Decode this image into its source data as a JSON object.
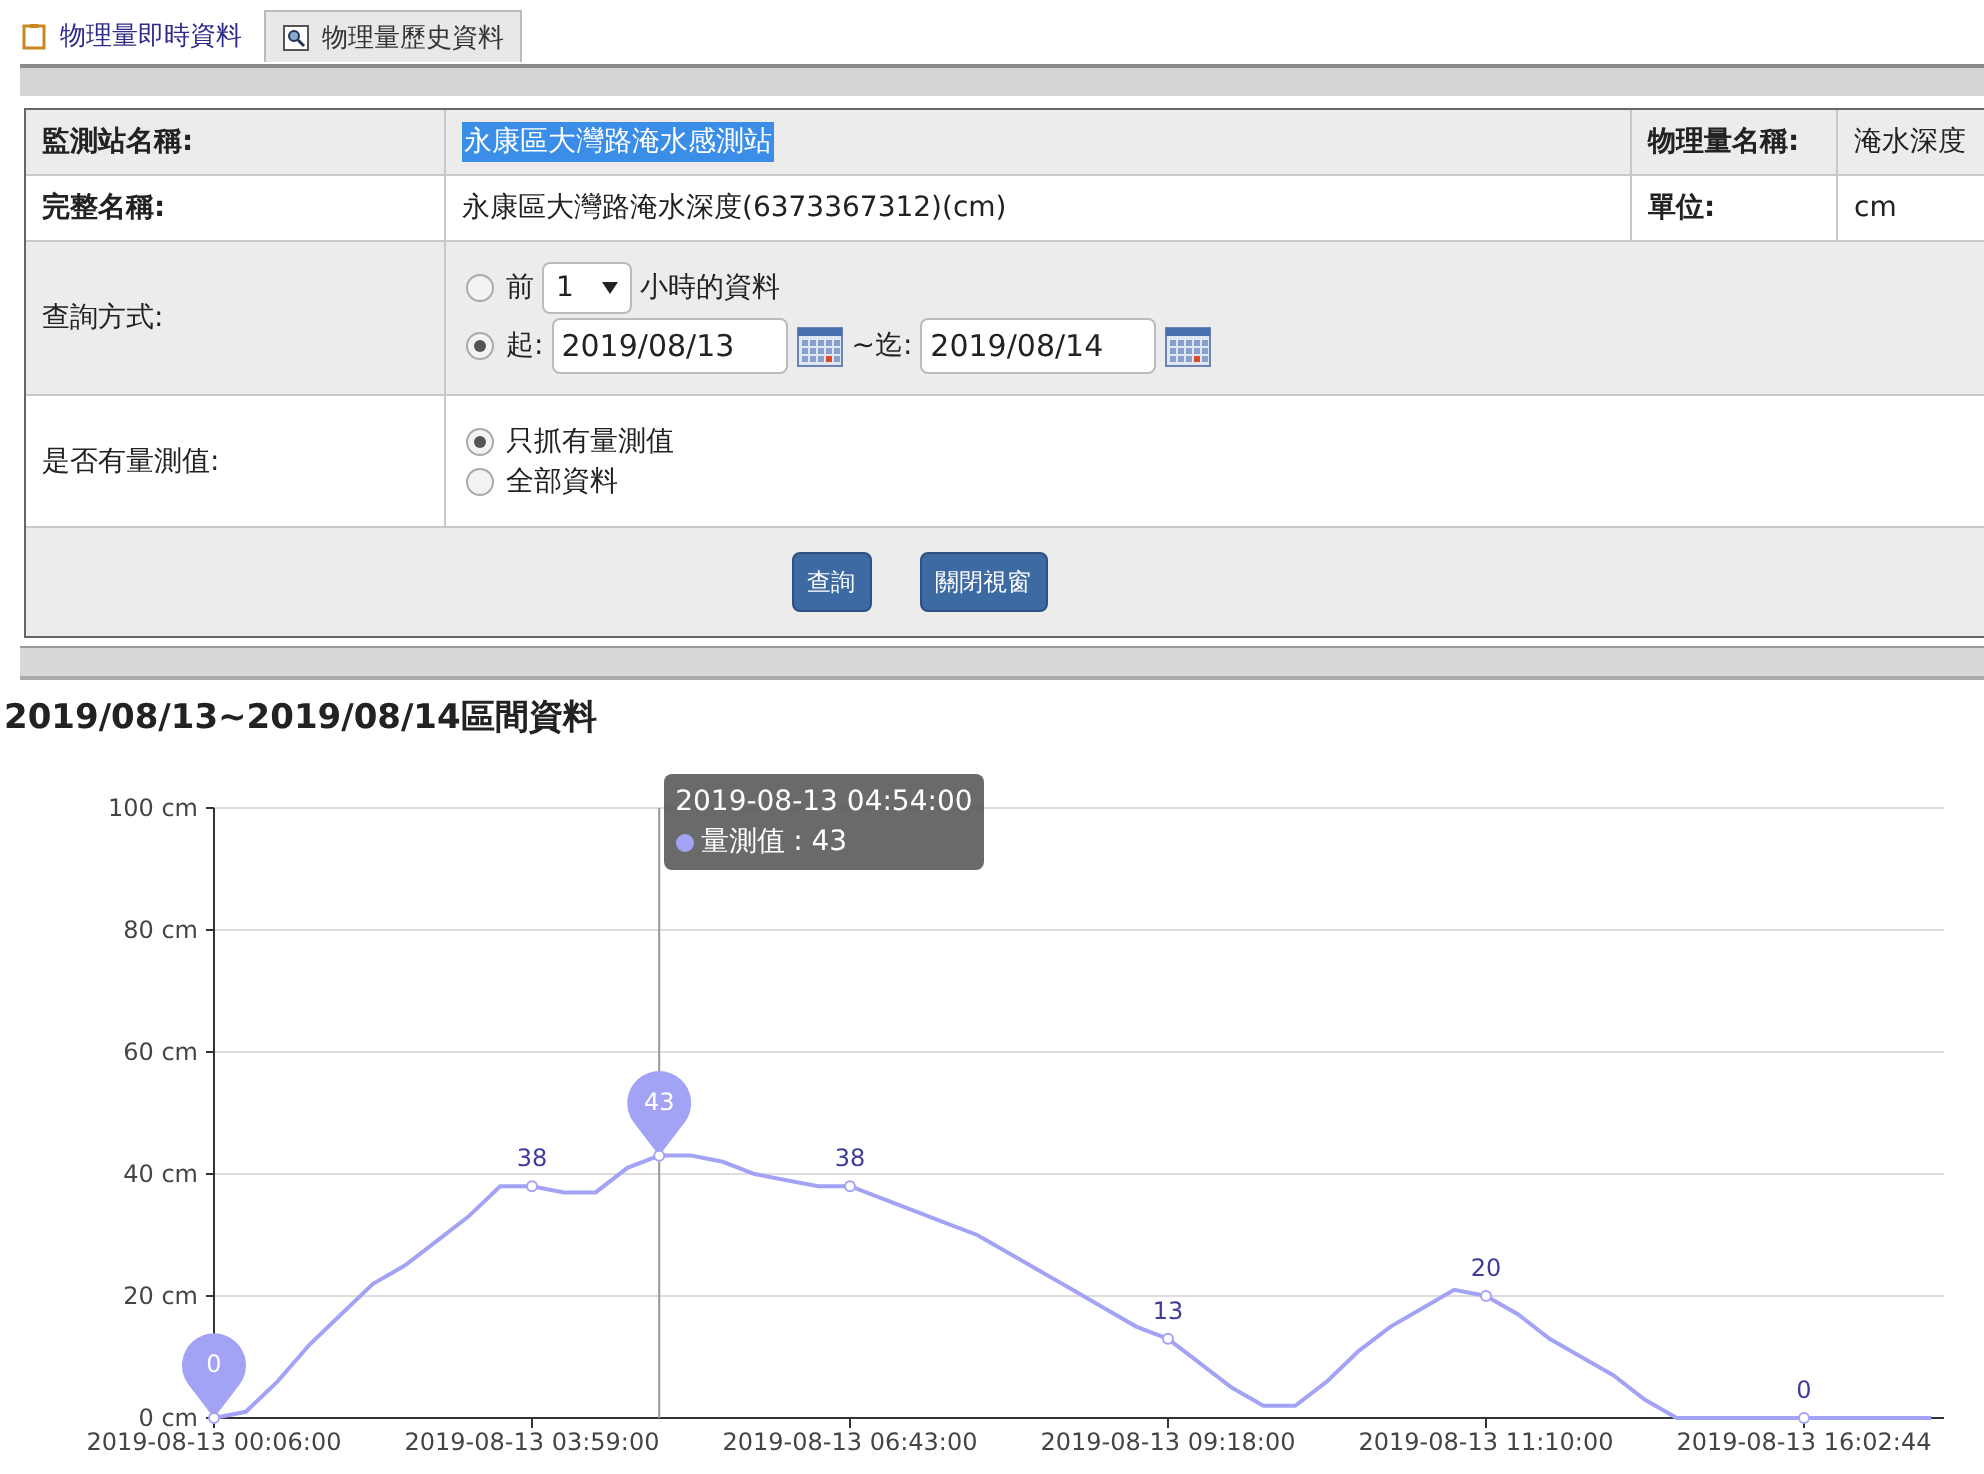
{
  "tabs": [
    {
      "label": "物理量即時資料",
      "selected": false
    },
    {
      "label": "物理量歷史資料",
      "selected": true
    }
  ],
  "info_rows": [
    {
      "label": "監測站名稱:",
      "value": "永康區大灣路淹水感測站",
      "highlighted": true,
      "label_2": "物理量名稱:",
      "value_2": "淹水深度"
    },
    {
      "label": "完整名稱:",
      "value": "永康區大灣路淹水深度(6373367312)(cm)",
      "highlighted": false,
      "label_2": "單位:",
      "value_2": "cm"
    }
  ],
  "query_mode": {
    "label": "查詢方式:",
    "options": [
      {
        "kind": "hours",
        "selected": false,
        "prefix": "前",
        "value": "1",
        "suffix": "小時的資料"
      },
      {
        "kind": "range",
        "selected": true,
        "start_label": "起:",
        "start": "2019/08/13",
        "end_label": "~迄:",
        "end": "2019/08/14"
      }
    ]
  },
  "value_filter": {
    "label": "是否有量測值:",
    "options": [
      {
        "label": "只抓有量測值",
        "selected": true
      },
      {
        "label": "全部資料",
        "selected": false
      }
    ]
  },
  "buttons": [
    "查詢",
    "關閉視窗"
  ],
  "heading": "2019/08/13~2019/08/14區間資料",
  "chart": {
    "chart_data": {
      "type": "line",
      "grid": true,
      "ylim": [
        0,
        100
      ],
      "yticks": [
        {
          "value": 0,
          "label": "0 cm"
        },
        {
          "value": 20,
          "label": "20 cm"
        },
        {
          "value": 40,
          "label": "40 cm"
        },
        {
          "value": 60,
          "label": "60 cm"
        },
        {
          "value": 80,
          "label": "80 cm"
        },
        {
          "value": 100,
          "label": "100 cm"
        }
      ],
      "categories": [
        "2019-08-13 00:06:00",
        null,
        null,
        null,
        null,
        null,
        null,
        null,
        null,
        null,
        "2019-08-13 03:59:00",
        null,
        null,
        null,
        null,
        null,
        null,
        null,
        null,
        null,
        "2019-08-13 06:43:00",
        null,
        null,
        null,
        null,
        null,
        null,
        null,
        null,
        null,
        "2019-08-13 09:18:00",
        null,
        null,
        null,
        null,
        null,
        null,
        null,
        null,
        null,
        "2019-08-13 11:10:00",
        null,
        null,
        null,
        null,
        null,
        null,
        null,
        null,
        null,
        "2019-08-13 16:02:44",
        null,
        null,
        null,
        null
      ],
      "series": [
        {
          "name": "量測值",
          "color": "#a3a3f5",
          "values": [
            0,
            1,
            6,
            12,
            17,
            22,
            25,
            29,
            33,
            38,
            38,
            37,
            37,
            41,
            43,
            43,
            42,
            40,
            39,
            38,
            38,
            36,
            34,
            32,
            30,
            27,
            24,
            21,
            18,
            15,
            13,
            9,
            5,
            2,
            2,
            6,
            11,
            15,
            18,
            21,
            20,
            17,
            13,
            10,
            7,
            3,
            0,
            0,
            0,
            0,
            0,
            0,
            0,
            0,
            0
          ]
        }
      ],
      "value_labels": [
        "0",
        null,
        null,
        null,
        null,
        null,
        null,
        null,
        null,
        null,
        "38",
        null,
        null,
        null,
        "43",
        null,
        null,
        null,
        null,
        null,
        "38",
        null,
        null,
        null,
        null,
        null,
        null,
        null,
        null,
        null,
        "13",
        null,
        null,
        null,
        null,
        null,
        null,
        null,
        null,
        null,
        "20",
        null,
        null,
        null,
        null,
        null,
        null,
        null,
        null,
        null,
        "0",
        null,
        null,
        null,
        null
      ]
    },
    "tooltip": {
      "title": "2019-08-13 04:54:00",
      "value": ": 43"
    }
  }
}
